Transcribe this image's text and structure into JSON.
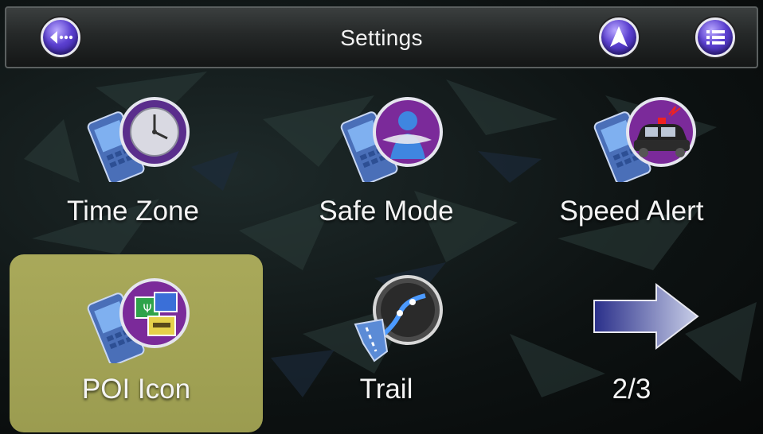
{
  "header": {
    "title": "Settings",
    "back_icon": "back-arrow-icon",
    "nav_icon": "navigation-arrow-icon",
    "menu_icon": "list-menu-icon"
  },
  "tiles": [
    {
      "label": "Time Zone",
      "icon": "clock-phone-icon",
      "selected": false
    },
    {
      "label": "Safe Mode",
      "icon": "person-phone-icon",
      "selected": false
    },
    {
      "label": "Speed Alert",
      "icon": "police-car-phone-icon",
      "selected": false
    },
    {
      "label": "POI Icon",
      "icon": "poi-icons-phone-icon",
      "selected": true
    },
    {
      "label": "Trail",
      "icon": "trail-route-icon",
      "selected": false
    },
    {
      "label": "2/3",
      "icon": "next-page-arrow-icon",
      "selected": false
    }
  ],
  "colors": {
    "selected_tile": "#a3a356",
    "button_purple": "#5b40d0",
    "icon_purple": "#7b2a9a"
  }
}
